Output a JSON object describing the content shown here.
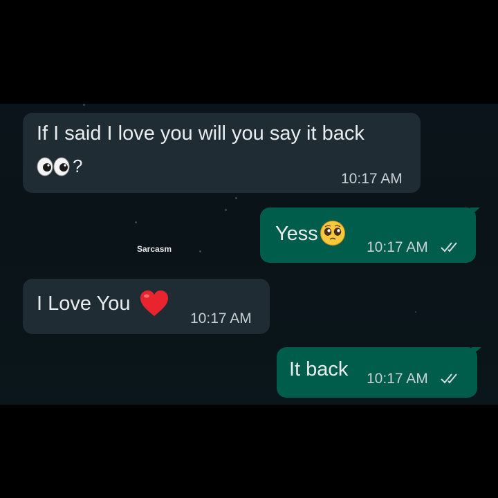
{
  "chat": {
    "messages": [
      {
        "direction": "incoming",
        "text_line1": "If I said I love you will you say it back",
        "text_line2_suffix": "?",
        "emoji": "eyes-emoji",
        "time": "10:17 AM"
      },
      {
        "direction": "outgoing",
        "text": "Yess",
        "emoji": "pleading-face-emoji",
        "time": "10:17 AM",
        "status": "read-double-check-icon"
      },
      {
        "direction": "incoming",
        "text": "I Love You",
        "emoji": "red-heart-emoji",
        "time": "10:17 AM"
      },
      {
        "direction": "outgoing",
        "text": "It back",
        "time": "10:17 AM",
        "status": "read-double-check-icon"
      }
    ],
    "watermark": "Sarcasm"
  },
  "colors": {
    "page_background": "#000000",
    "chat_background": "#0b141a",
    "incoming_bubble": "#1f2c33",
    "outgoing_bubble": "#005c4b",
    "text": "#e9edef"
  }
}
